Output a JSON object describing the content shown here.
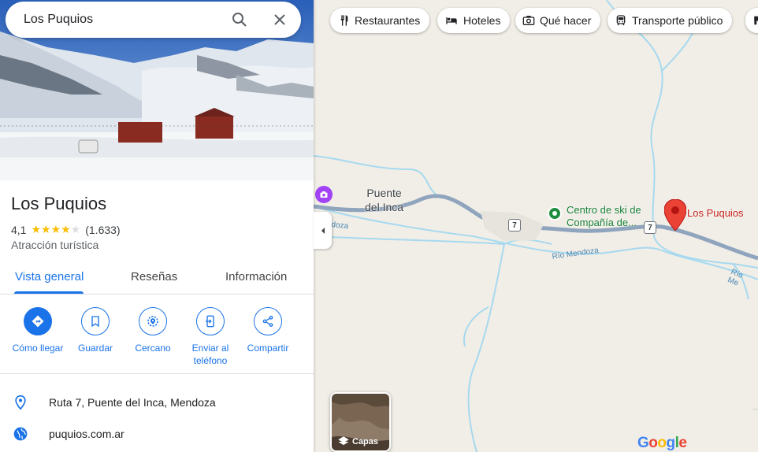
{
  "search": {
    "query": "Los Puquios"
  },
  "place": {
    "title": "Los Puquios",
    "rating": "4,1",
    "stars": 4.1,
    "review_count": "(1.633)",
    "category": "Atracción turística"
  },
  "tabs": [
    {
      "label": "Vista general",
      "active": true
    },
    {
      "label": "Reseñas",
      "active": false
    },
    {
      "label": "Información",
      "active": false
    }
  ],
  "actions": [
    {
      "label": "Cómo llegar",
      "icon": "directions-icon"
    },
    {
      "label": "Guardar",
      "icon": "bookmark-icon"
    },
    {
      "label": "Cercano",
      "icon": "nearby-icon"
    },
    {
      "label": "Enviar al teléfono",
      "icon": "send-to-phone-icon"
    },
    {
      "label": "Compartir",
      "icon": "share-icon"
    }
  ],
  "info": {
    "address": "Ruta 7, Puente del Inca, Mendoza",
    "website": "puquios.com.ar"
  },
  "chips": [
    {
      "label": "Restaurantes",
      "icon": "fork-knife-icon"
    },
    {
      "label": "Hoteles",
      "icon": "bed-icon"
    },
    {
      "label": "Qué hacer",
      "icon": "camera-icon"
    },
    {
      "label": "Transporte público",
      "icon": "train-icon"
    }
  ],
  "map": {
    "town_line1": "Puente",
    "town_line2": "del Inca",
    "ski_line1": "Centro de ski de",
    "ski_line2": "Compañía de...",
    "pin_label": "Los Puquios",
    "route_number": "7",
    "river_1": "Río Mendoza",
    "river_2": "Río Me",
    "river_3": "doza",
    "layers_label": "Capas",
    "logo_text": "Google"
  },
  "colors": {
    "accent": "#1a73e8",
    "pin": "#ea4335",
    "ski_green": "#188038",
    "map_bg": "#f1eee7",
    "road": "#8ea3bc",
    "river": "#a6d8ee"
  }
}
